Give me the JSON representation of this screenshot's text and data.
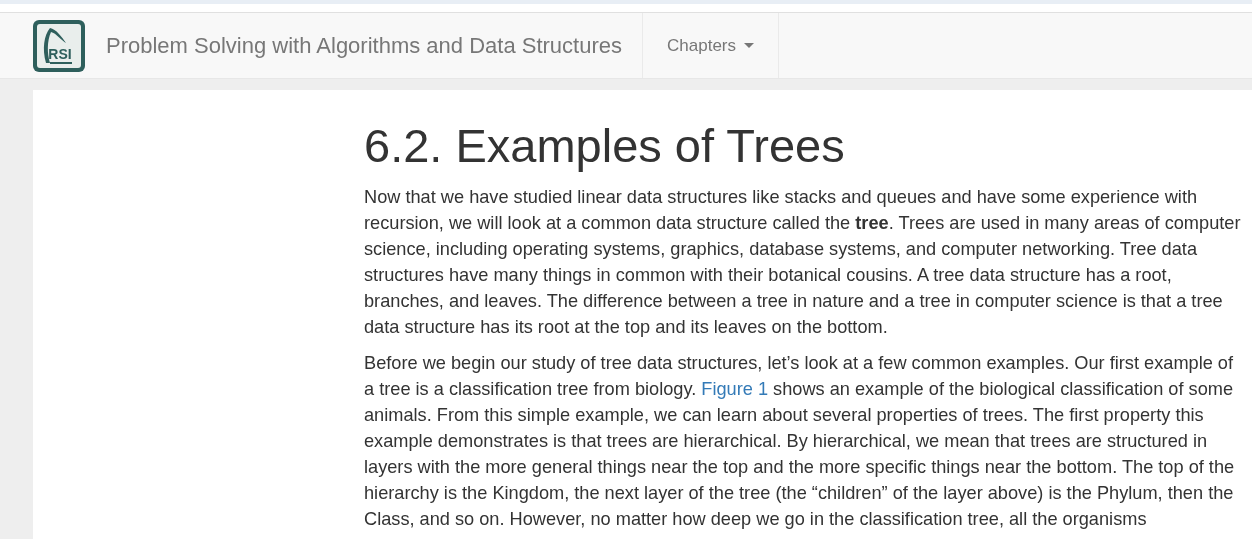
{
  "navbar": {
    "logo_text": "RSI",
    "brand": "Problem Solving with Algorithms and Data Structures",
    "menu": {
      "label": "Chapters",
      "expanded": false
    }
  },
  "article": {
    "heading": "6.2. Examples of Trees",
    "paragraphs": [
      {
        "parts": [
          {
            "kind": "text",
            "text": "Now that we have studied linear data structures like stacks and queues and have some experience with recursion, we will look at a common data structure called the **tree**. Trees are used in many areas of computer science, including operating systems, graphics, database systems, and computer networking. Tree data structures have many things in common with their botanical cousins. A tree data structure has a root, branches, and leaves. The difference between a tree in nature and a tree in computer science is that a tree data structure has its root at the top and its leaves on the bottom."
          }
        ]
      },
      {
        "parts": [
          {
            "kind": "text",
            "text": "Before we begin our study of tree data structures, let’s look at a few common examples. Our first example of a tree is a classification tree from biology. "
          },
          {
            "kind": "link",
            "text": "Figure 1"
          },
          {
            "kind": "text",
            "text": " shows an example of the biological classification of some animals. From this simple example, we can learn about several properties of trees. The first property this example demonstrates is that trees are hierarchical. By hierarchical, we mean that trees are structured in layers with the more general things near the top and the more specific things near the bottom. The top of the hierarchy is the Kingdom, the next layer of the tree (the “children” of the layer above) is the Phylum, then the Class, and so on. However, no matter how deep we go in the classification tree, all the organisms"
          }
        ]
      }
    ]
  }
}
